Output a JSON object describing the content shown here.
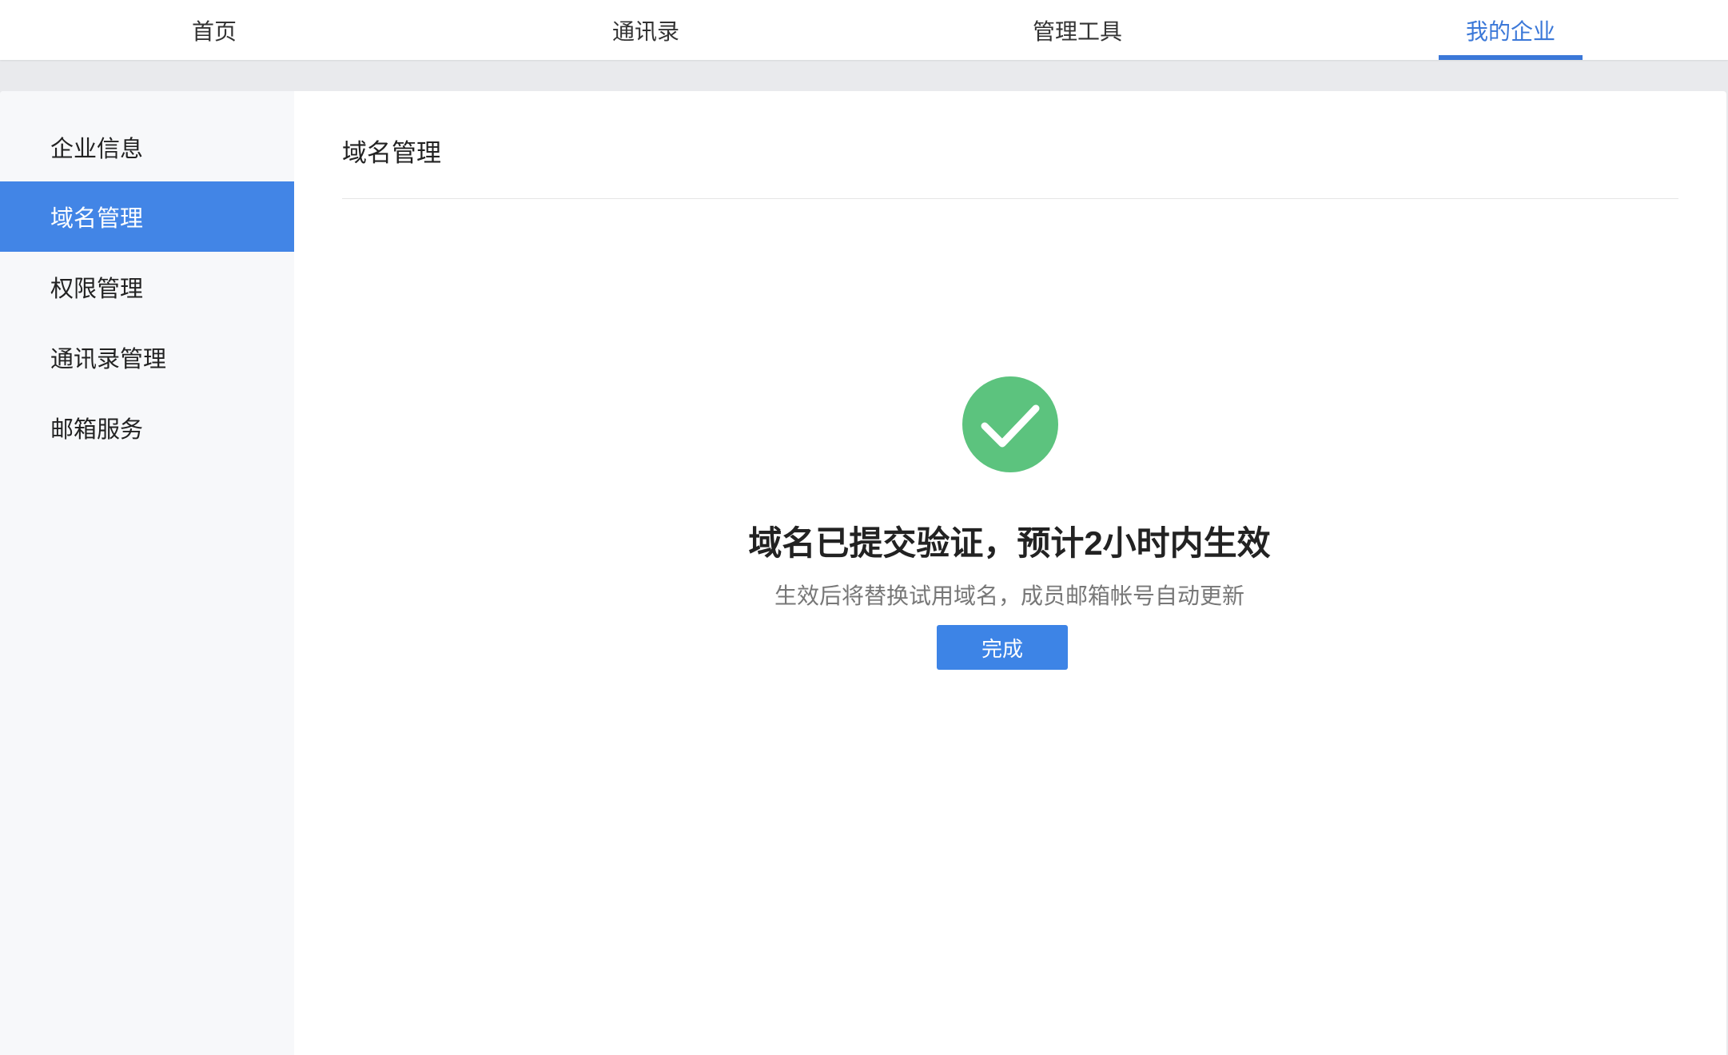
{
  "topnav": {
    "items": [
      {
        "label": "首页"
      },
      {
        "label": "通讯录"
      },
      {
        "label": "管理工具"
      },
      {
        "label": "我的企业"
      }
    ],
    "active_index": 3
  },
  "sidebar": {
    "items": [
      {
        "label": "企业信息"
      },
      {
        "label": "域名管理"
      },
      {
        "label": "权限管理"
      },
      {
        "label": "通讯录管理"
      },
      {
        "label": "邮箱服务"
      }
    ],
    "active_index": 1
  },
  "main": {
    "title": "域名管理",
    "status_icon": "check-circle-icon",
    "message": "域名已提交验证，预计2小时内生效",
    "submessage": "生效后将替换试用域名，成员邮箱帐号自动更新",
    "done_label": "完成"
  },
  "colors": {
    "accent": "#3b78d8",
    "sidebar_active": "#4285e6",
    "success": "#5cc37e"
  }
}
